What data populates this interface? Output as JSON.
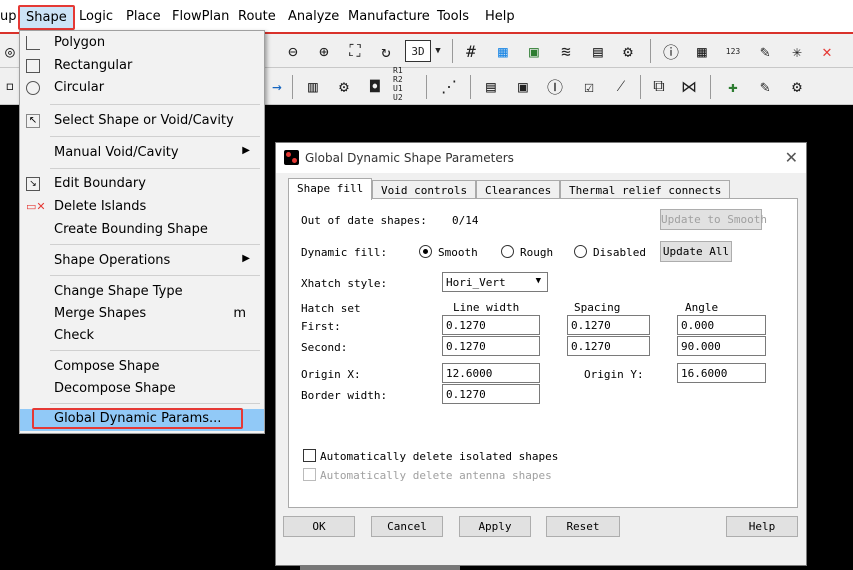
{
  "menubar": {
    "items": [
      "up",
      "Shape",
      "Logic",
      "Place",
      "FlowPlan",
      "Route",
      "Analyze",
      "Manufacture",
      "Tools",
      "Help"
    ]
  },
  "toolbar": {
    "view_3d_label": "3D",
    "row1_badge": "123",
    "refdes_labels": [
      "R1 R2",
      "U1 U2"
    ]
  },
  "shape_menu": {
    "items": [
      "Polygon",
      "Rectangular",
      "Circular",
      "Select Shape or Void/Cavity",
      "Manual Void/Cavity",
      "Edit Boundary",
      "Delete Islands",
      "Create Bounding Shape",
      "Shape Operations",
      "Change Shape Type",
      "Merge Shapes",
      "Check",
      "Compose Shape",
      "Decompose Shape",
      "Global Dynamic Params..."
    ],
    "merge_shortcut": "m"
  },
  "dialog": {
    "title": "Global Dynamic Shape Parameters",
    "tabs": [
      "Shape fill",
      "Void controls",
      "Clearances",
      "Thermal relief connects"
    ],
    "out_of_date_label": "Out of date shapes:",
    "out_of_date_value": "0/14",
    "update_to_smooth": "Update to Smooth",
    "dynamic_fill_label": "Dynamic fill:",
    "fill_options": [
      "Smooth",
      "Rough",
      "Disabled"
    ],
    "update_all": "Update All",
    "xhatch_label": "Xhatch style:",
    "xhatch_value": "Hori_Vert",
    "hatch_set_label": "Hatch set",
    "col_line_width": "Line width",
    "col_spacing": "Spacing",
    "col_angle": "Angle",
    "first_label": "First:",
    "second_label": "Second:",
    "first": {
      "line_width": "0.1270",
      "spacing": "0.1270",
      "angle": "0.000"
    },
    "second": {
      "line_width": "0.1270",
      "spacing": "0.1270",
      "angle": "90.000"
    },
    "origin_x_label": "Origin X:",
    "origin_x": "12.6000",
    "origin_y_label": "Origin Y:",
    "origin_y": "16.6000",
    "border_width_label": "Border width:",
    "border_width": "0.1270",
    "auto_delete_isolated": "Automatically delete isolated shapes",
    "auto_delete_antenna": "Automatically delete antenna shapes",
    "buttons": {
      "ok": "OK",
      "cancel": "Cancel",
      "apply": "Apply",
      "reset": "Reset",
      "help": "Help"
    }
  }
}
